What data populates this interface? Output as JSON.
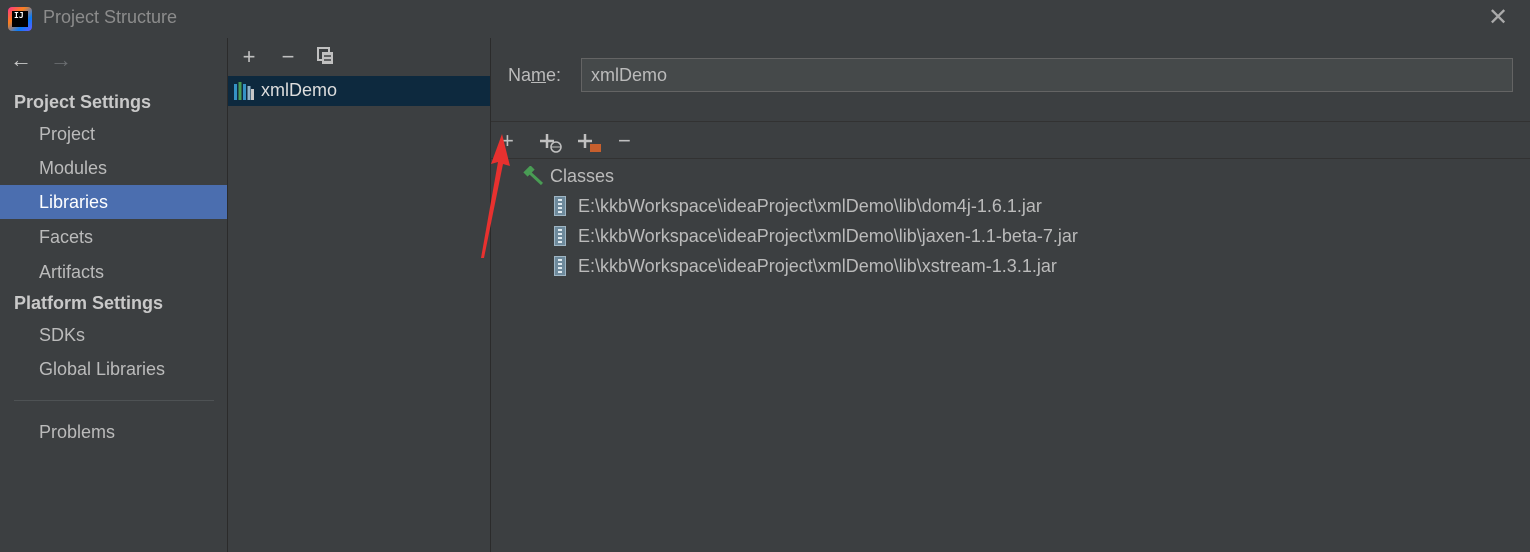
{
  "window": {
    "title": "Project Structure",
    "app_icon": "intellij-idea-icon",
    "app_icon_text": "IJ",
    "close_icon": "close-icon"
  },
  "sidebar": {
    "nav": {
      "back_glyph": "←",
      "forward_glyph": "→"
    },
    "section_project": "Project Settings",
    "project_items": [
      {
        "label": "Project",
        "selected": false
      },
      {
        "label": "Modules",
        "selected": false
      },
      {
        "label": "Libraries",
        "selected": true
      },
      {
        "label": "Facets",
        "selected": false
      },
      {
        "label": "Artifacts",
        "selected": false
      }
    ],
    "section_platform": "Platform Settings",
    "platform_items": [
      {
        "label": "SDKs"
      },
      {
        "label": "Global Libraries"
      }
    ],
    "problems": "Problems"
  },
  "libraries_panel": {
    "toolbar": {
      "add_glyph": "+",
      "remove_glyph": "−",
      "copy_glyph": "⧉"
    },
    "items": [
      {
        "label": "xmlDemo",
        "icon": "library-icon",
        "selected": true
      }
    ]
  },
  "details": {
    "name_label_prefix": "Na",
    "name_label_mnemonic": "m",
    "name_label_suffix": "e:",
    "name_value": "xmlDemo",
    "toolbar": {
      "add_glyph": "+",
      "add_url_icon": "add-url-icon",
      "add_jar_dir_icon": "add-jar-directory-icon",
      "remove_glyph": "−"
    },
    "tree": {
      "root": {
        "label": "Classes",
        "icon": "hammer-icon"
      },
      "children": [
        {
          "label": "E:\\kkbWorkspace\\ideaProject\\xmlDemo\\lib\\dom4j-1.6.1.jar",
          "icon": "jar-icon"
        },
        {
          "label": "E:\\kkbWorkspace\\ideaProject\\xmlDemo\\lib\\jaxen-1.1-beta-7.jar",
          "icon": "jar-icon"
        },
        {
          "label": "E:\\kkbWorkspace\\ideaProject\\xmlDemo\\lib\\xstream-1.3.1.jar",
          "icon": "jar-icon"
        }
      ]
    }
  },
  "annotation": {
    "arrow_color": "#e8312f",
    "arrow_icon": "red-arrow-annotation"
  },
  "colors": {
    "background": "#3c3f41",
    "selection": "#4b6eaf",
    "list_selection": "#0d293e",
    "text": "#bbbbbb"
  }
}
